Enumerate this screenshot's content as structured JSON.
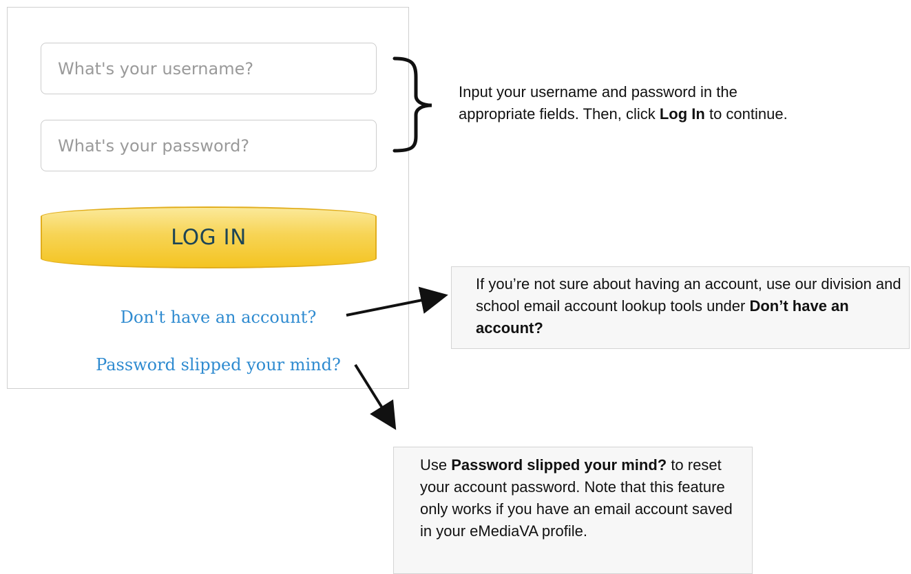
{
  "login": {
    "username_placeholder": "What's your username?",
    "password_placeholder": "What's your password?",
    "login_label": "LOG IN",
    "no_account_link": "Don't have an account?",
    "forgot_password_link": "Password slipped your mind?"
  },
  "annotations": {
    "credentials": {
      "before": "Input your username and password in the appropriate fields. Then, click ",
      "emphasis": "Log In",
      "after": " to continue."
    },
    "account": {
      "before": "If you’re not sure about having an account, use our division and school email account lookup tools under ",
      "emphasis": "Don’t have an account?",
      "after": ""
    },
    "password": {
      "before": "Use ",
      "emphasis": "Password slipped your mind?",
      "after": " to reset your account password. Note that this feature only works if you have an email account saved in your eMediaVA profile."
    }
  },
  "colors": {
    "link": "#2f8bd0",
    "button_gradient_top": "#fbe99a",
    "button_gradient_bottom": "#f4c422",
    "button_border": "#e1ad1c",
    "button_text": "#1d4555",
    "note_box_background": "#f7f7f7"
  }
}
